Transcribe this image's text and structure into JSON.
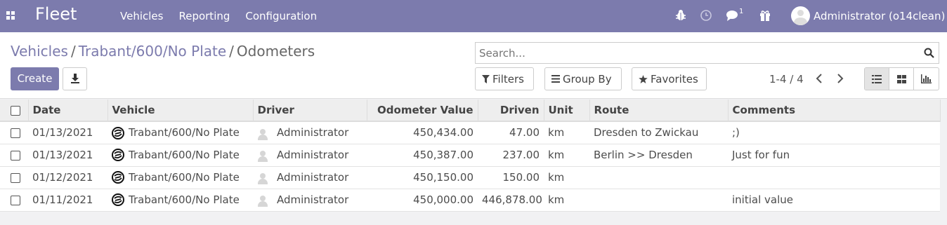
{
  "navbar": {
    "app_name": "Fleet",
    "menu": [
      "Vehicles",
      "Reporting",
      "Configuration"
    ],
    "messages_count": "1",
    "user": "Administrator (o14clean)"
  },
  "breadcrumb": {
    "items": [
      "Vehicles",
      "Trabant/600/No Plate"
    ],
    "current": "Odometers"
  },
  "toolbar": {
    "create_label": "Create",
    "search_placeholder": "Search...",
    "filters_label": "Filters",
    "groupby_label": "Group By",
    "favorites_label": "Favorites",
    "pager": "1-4 / 4"
  },
  "table": {
    "headers": [
      "Date",
      "Vehicle",
      "Driver",
      "Odometer Value",
      "Driven",
      "Unit",
      "Route",
      "Comments"
    ],
    "rows": [
      {
        "date": "01/13/2021",
        "vehicle": "Trabant/600/No Plate",
        "driver": "Administrator",
        "odometer": "450,434.00",
        "driven": "47.00",
        "unit": "km",
        "route": "Dresden to Zwickau",
        "comments": ";)"
      },
      {
        "date": "01/13/2021",
        "vehicle": "Trabant/600/No Plate",
        "driver": "Administrator",
        "odometer": "450,387.00",
        "driven": "237.00",
        "unit": "km",
        "route": "Berlin >> Dresden",
        "comments": "Just for fun"
      },
      {
        "date": "01/12/2021",
        "vehicle": "Trabant/600/No Plate",
        "driver": "Administrator",
        "odometer": "450,150.00",
        "driven": "150.00",
        "unit": "km",
        "route": "",
        "comments": ""
      },
      {
        "date": "01/11/2021",
        "vehicle": "Trabant/600/No Plate",
        "driver": "Administrator",
        "odometer": "450,000.00",
        "driven": "446,878.00",
        "unit": "km",
        "route": "",
        "comments": "initial value"
      }
    ]
  },
  "colors": {
    "brand": "#7c7bad"
  }
}
